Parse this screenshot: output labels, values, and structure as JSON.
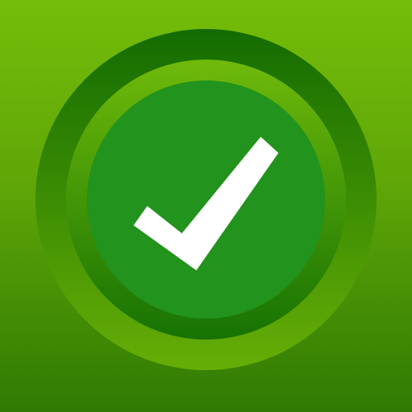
{
  "icon": {
    "name": "checkmark-icon",
    "colors": {
      "background_top": "#74bd0a",
      "background_mid": "#5fa607",
      "background_bottom": "#2f7a03",
      "outer_ring_top": "#136c01",
      "outer_ring_bottom": "#66ae06",
      "inner_ring_top": "#6fba0a",
      "inner_ring_bottom": "#167203",
      "center_disc": "#22931c",
      "checkmark": "#ffffff"
    }
  }
}
